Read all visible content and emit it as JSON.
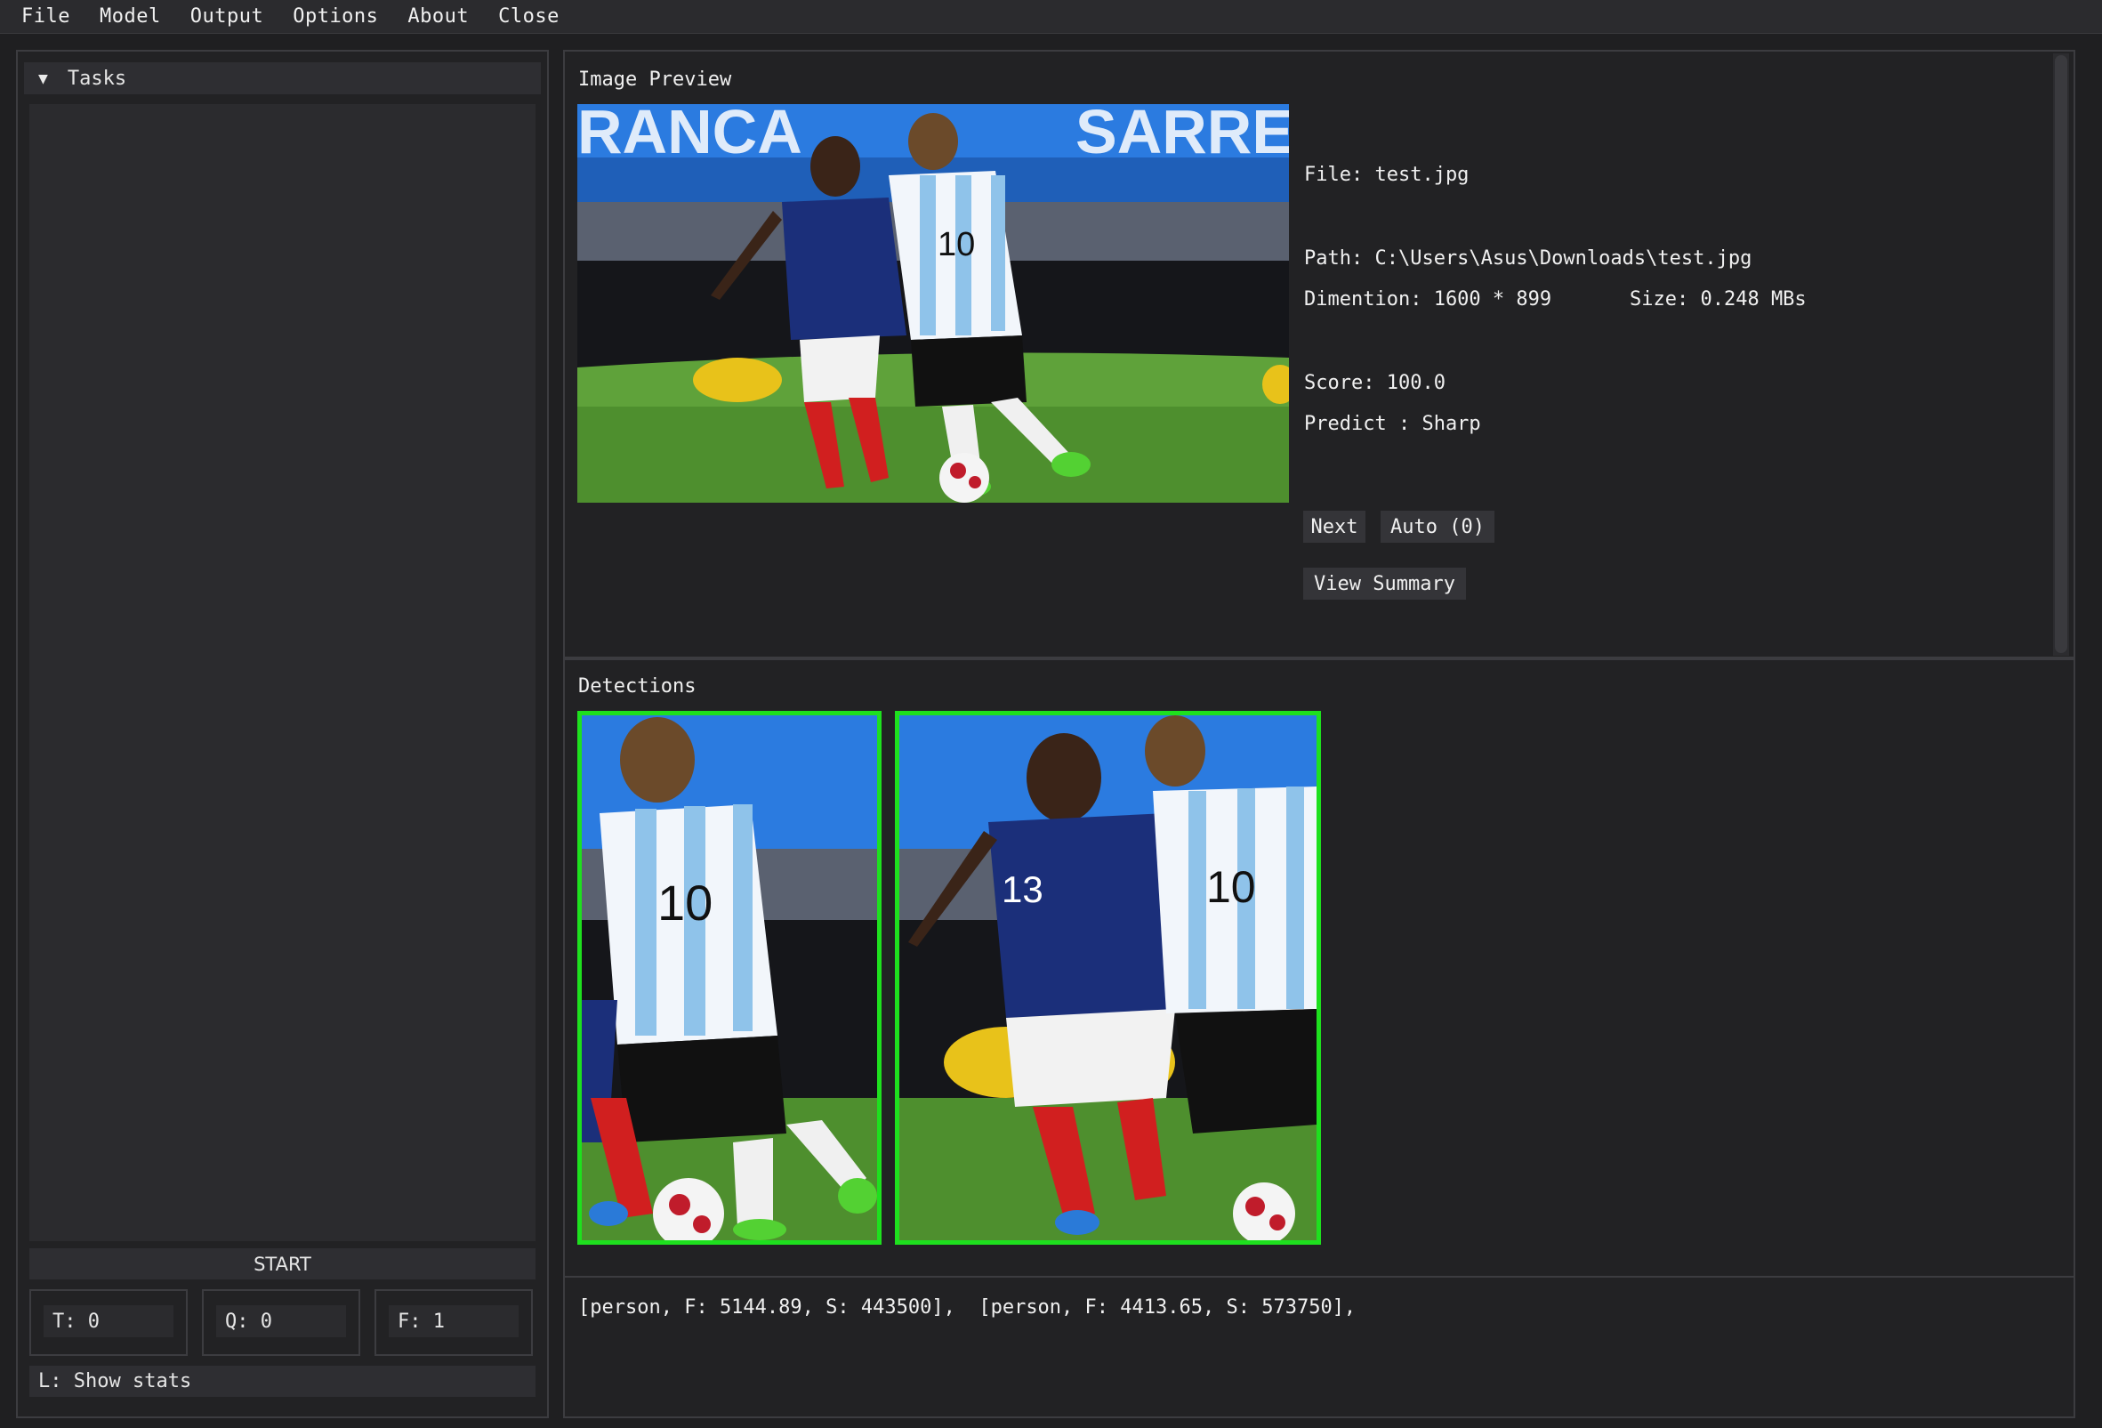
{
  "menu": [
    "File",
    "Model",
    "Output",
    "Options",
    "About",
    "Close"
  ],
  "tasks": {
    "header": "Tasks",
    "start_label": "START",
    "stats": {
      "t": "T: 0",
      "q": "Q: 0",
      "f": "F: 1"
    },
    "show_stats": "L: Show stats"
  },
  "preview": {
    "title": "Image Preview",
    "file": "File: test.jpg",
    "path": "Path: C:\\Users\\Asus\\Downloads\\test.jpg",
    "dimension": "Dimention: 1600 * 899",
    "size": "Size: 0.248 MBs",
    "score": "Score: 100.0",
    "predict": "Predict : Sharp",
    "buttons": {
      "next": "Next",
      "auto": "Auto (0)",
      "view_summary": "View Summary"
    }
  },
  "detections": {
    "title": "Detections",
    "result_text": "[person, F: 5144.89, S: 443500],  [person, F: 4413.65, S: 573750],",
    "box_color": "#1ee01e"
  },
  "icons": {
    "collapse": "triangle-down-icon"
  }
}
